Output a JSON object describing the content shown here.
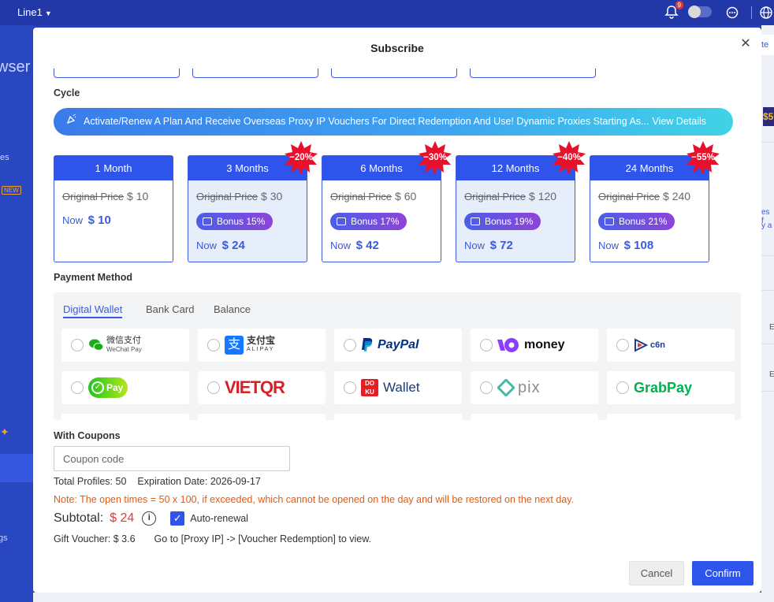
{
  "topbar": {
    "line": "Line1",
    "notif_count": "9"
  },
  "bg": {
    "left_title": "wser",
    "left_item": "es",
    "left_new": "NEW",
    "left_item2": "gs",
    "right_tab": "te",
    "right_gold": "$5",
    "right_txt1": "es f",
    "right_txt2": "y a",
    "right_e1": "E",
    "right_e2": "E"
  },
  "modal": {
    "title": "Subscribe",
    "cycle_label": "Cycle",
    "banner_text": "Activate/Renew A Plan And Receive Overseas Proxy IP Vouchers For Direct Redemption And Use! Dynamic Proxies Starting As...",
    "banner_link": "View Details"
  },
  "plans": [
    {
      "name": "1 Month",
      "original_label": "Original Price",
      "original": "$ 10",
      "now_label": "Now",
      "now": "$ 10"
    },
    {
      "name": "3 Months",
      "original_label": "Original Price",
      "original": "$ 30",
      "bonus": "Bonus 15%",
      "now_label": "Now",
      "now": "$ 24",
      "discount": "−20%"
    },
    {
      "name": "6 Months",
      "original_label": "Original Price",
      "original": "$ 60",
      "bonus": "Bonus 17%",
      "now_label": "Now",
      "now": "$ 42",
      "discount": "−30%"
    },
    {
      "name": "12 Months",
      "original_label": "Original Price",
      "original": "$ 120",
      "bonus": "Bonus 19%",
      "now_label": "Now",
      "now": "$ 72",
      "discount": "−40%"
    },
    {
      "name": "24 Months",
      "original_label": "Original Price",
      "original": "$ 240",
      "bonus": "Bonus 21%",
      "now_label": "Now",
      "now": "$ 108",
      "discount": "−55%"
    }
  ],
  "payment": {
    "label": "Payment Method",
    "tabs": [
      "Digital Wallet",
      "Bank Card",
      "Balance"
    ],
    "methods": [
      {
        "name": "微信支付",
        "sub": "WeChat Pay"
      },
      {
        "name": "支付宝",
        "sub": "ALIPAY"
      },
      {
        "name": "PayPal"
      },
      {
        "name": "money"
      },
      {
        "name": "c6n"
      },
      {
        "name": "Pay"
      },
      {
        "name": "VIETQR"
      },
      {
        "name": "Wallet"
      },
      {
        "name": "pix"
      },
      {
        "name": "GrabPay"
      }
    ]
  },
  "coupons": {
    "label": "With Coupons",
    "placeholder": "Coupon code"
  },
  "summary": {
    "total_profiles": "Total Profiles: 50",
    "expiration": "Expiration Date: 2026-09-17",
    "note": "Note: The open times = 50 x 100, if exceeded, which cannot be opened on the day and will be restored on the next day.",
    "subtotal_label": "Subtotal:",
    "subtotal_amount": "$ 24",
    "auto_renewal": "Auto-renewal",
    "gift_voucher": "Gift Voucher: $ 3.6",
    "goto": "Go to [Proxy IP] -> [Voucher Redemption] to view."
  },
  "buttons": {
    "cancel": "Cancel",
    "confirm": "Confirm"
  },
  "colors": {
    "primary": "#2f54eb",
    "price_red": "#e53935",
    "note_orange": "#e8590c",
    "burst_red": "#e8102a"
  }
}
